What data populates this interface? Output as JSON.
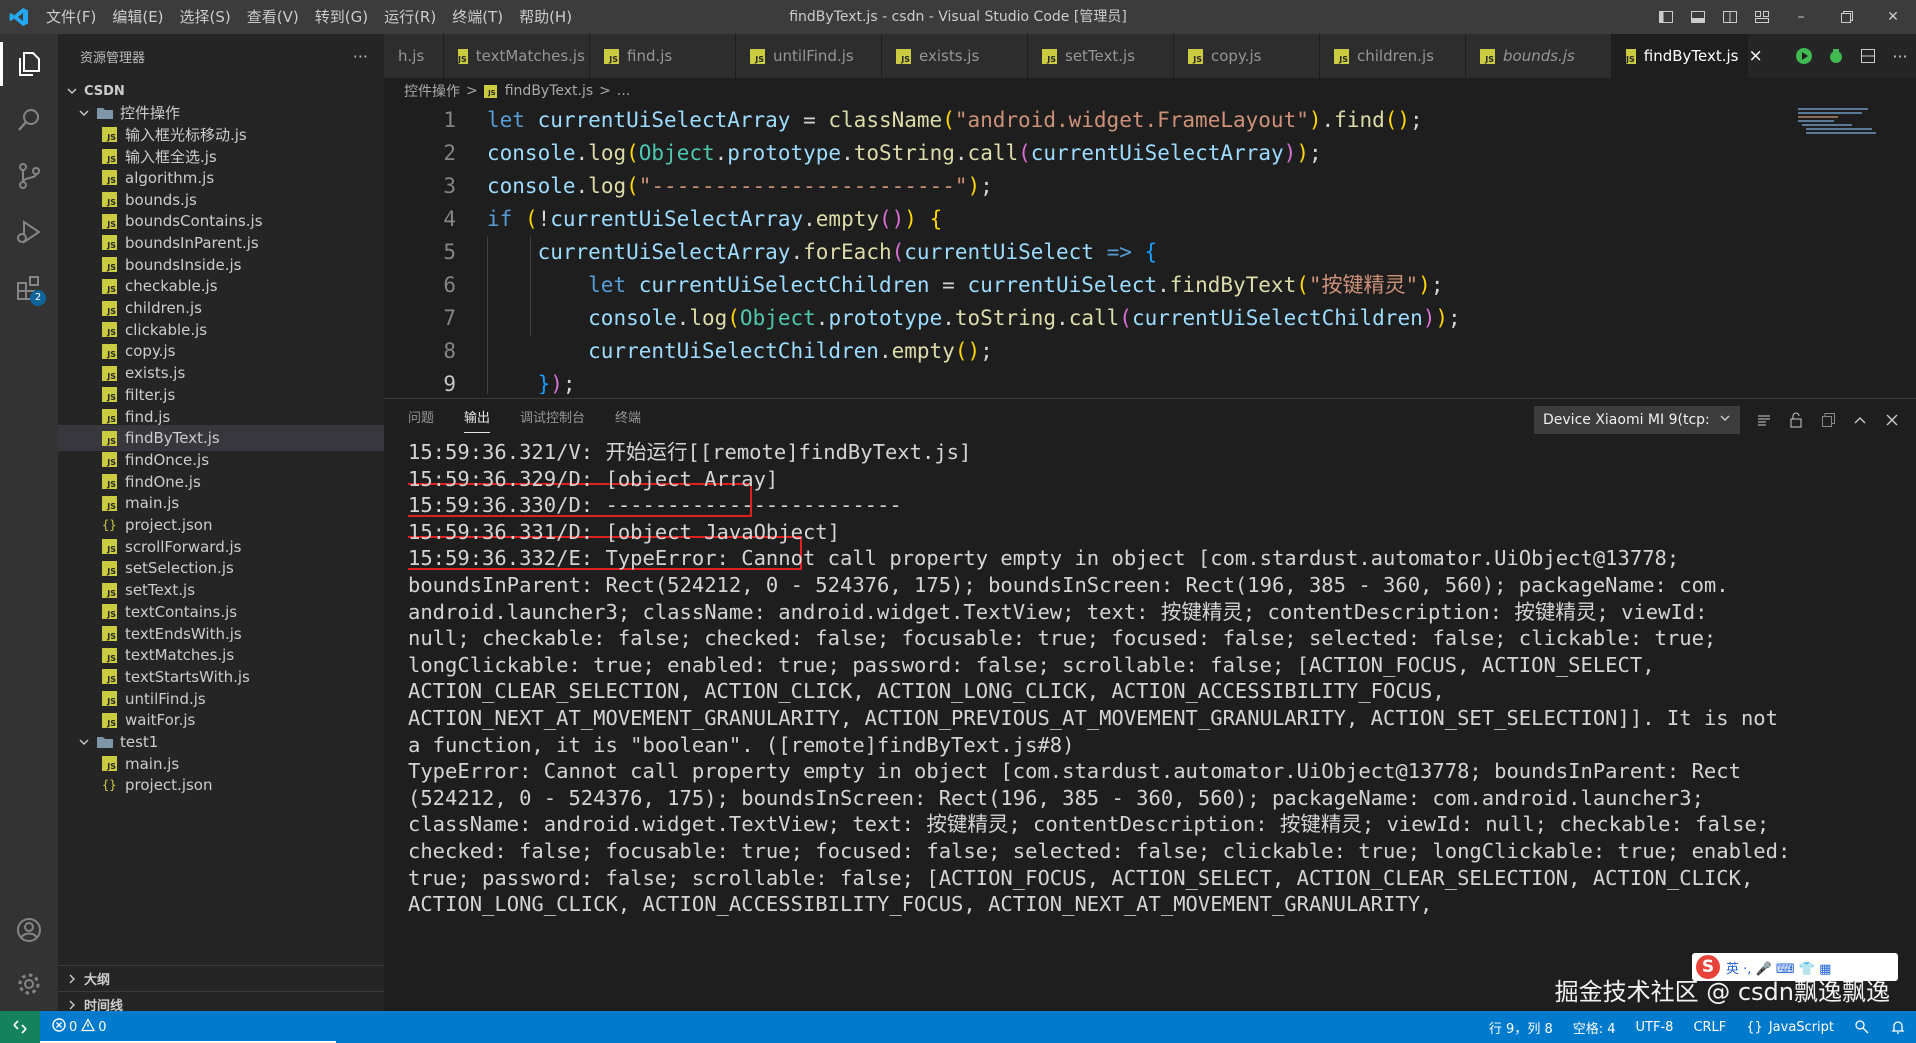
{
  "window": {
    "title": "findByText.js - csdn - Visual Studio Code [管理员]",
    "menu": [
      "文件(F)",
      "编辑(E)",
      "选择(S)",
      "查看(V)",
      "转到(G)",
      "运行(R)",
      "终端(T)",
      "帮助(H)"
    ]
  },
  "activity": {
    "extensions_badge": "2"
  },
  "sidebar": {
    "header": "资源管理器",
    "more": "···",
    "root": "CSDN",
    "folder1": "控件操作",
    "files1": [
      "输入框光标移动.js",
      "输入框全选.js",
      "algorithm.js",
      "bounds.js",
      "boundsContains.js",
      "boundsInParent.js",
      "boundsInside.js",
      "checkable.js",
      "children.js",
      "clickable.js",
      "copy.js",
      "exists.js",
      "filter.js",
      "find.js",
      "findByText.js",
      "findOnce.js",
      "findOne.js",
      "main.js",
      "project.json",
      "scrollForward.js",
      "setSelection.js",
      "setText.js",
      "textContains.js",
      "textEndsWith.js",
      "textMatches.js",
      "textStartsWith.js",
      "untilFind.js",
      "waitFor.js"
    ],
    "folder2": "test1",
    "files2": [
      "main.js",
      "project.json"
    ],
    "outline": "大纲",
    "timeline": "时间线"
  },
  "tabs": [
    {
      "label": "h.js",
      "active": false
    },
    {
      "label": "textMatches.js",
      "active": false
    },
    {
      "label": "find.js",
      "active": false
    },
    {
      "label": "untilFind.js",
      "active": false
    },
    {
      "label": "exists.js",
      "active": false
    },
    {
      "label": "setText.js",
      "active": false
    },
    {
      "label": "copy.js",
      "active": false
    },
    {
      "label": "children.js",
      "active": false
    },
    {
      "label": "bounds.js",
      "active": false
    },
    {
      "label": "findByText.js",
      "active": true
    }
  ],
  "breadcrumb": {
    "folder": "控件操作",
    "file": "findByText.js",
    "more": "..."
  },
  "code_lines": [
    {
      "n": "1",
      "tokens": [
        [
          "kw",
          "let "
        ],
        [
          "var",
          "currentUiSelectArray"
        ],
        [
          "pun",
          " = "
        ],
        [
          "fn",
          "className"
        ],
        [
          "br1",
          "("
        ],
        [
          "str",
          "\"android.widget.FrameLayout\""
        ],
        [
          "br1",
          ")"
        ],
        [
          "pun",
          "."
        ],
        [
          "fn",
          "find"
        ],
        [
          "br1",
          "()"
        ],
        [
          "pun",
          ";"
        ]
      ]
    },
    {
      "n": "2",
      "tokens": [
        [
          "var",
          "console"
        ],
        [
          "pun",
          "."
        ],
        [
          "fn",
          "log"
        ],
        [
          "br1",
          "("
        ],
        [
          "cls",
          "Object"
        ],
        [
          "pun",
          "."
        ],
        [
          "var",
          "prototype"
        ],
        [
          "pun",
          "."
        ],
        [
          "fn",
          "toString"
        ],
        [
          "pun",
          "."
        ],
        [
          "fn",
          "call"
        ],
        [
          "br2",
          "("
        ],
        [
          "var",
          "currentUiSelectArray"
        ],
        [
          "br2",
          ")"
        ],
        [
          "br1",
          ")"
        ],
        [
          "pun",
          ";"
        ]
      ]
    },
    {
      "n": "3",
      "tokens": [
        [
          "var",
          "console"
        ],
        [
          "pun",
          "."
        ],
        [
          "fn",
          "log"
        ],
        [
          "br1",
          "("
        ],
        [
          "str",
          "\"------------------------\""
        ],
        [
          "br1",
          ")"
        ],
        [
          "pun",
          ";"
        ]
      ]
    },
    {
      "n": "4",
      "tokens": [
        [
          "kw",
          "if "
        ],
        [
          "br1",
          "("
        ],
        [
          "pun",
          "!"
        ],
        [
          "var",
          "currentUiSelectArray"
        ],
        [
          "pun",
          "."
        ],
        [
          "fn",
          "empty"
        ],
        [
          "br2",
          "()"
        ],
        [
          "br1",
          ")"
        ],
        [
          "pun",
          " "
        ],
        [
          "br1",
          "{"
        ]
      ]
    },
    {
      "n": "5",
      "tokens": [
        [
          "pun",
          "    "
        ],
        [
          "var",
          "currentUiSelectArray"
        ],
        [
          "pun",
          "."
        ],
        [
          "fn",
          "forEach"
        ],
        [
          "br2",
          "("
        ],
        [
          "var",
          "currentUiSelect"
        ],
        [
          "pun",
          " "
        ],
        [
          "kw",
          "=>"
        ],
        [
          "pun",
          " "
        ],
        [
          "br3",
          "{"
        ]
      ]
    },
    {
      "n": "6",
      "tokens": [
        [
          "pun",
          "        "
        ],
        [
          "kw",
          "let "
        ],
        [
          "var",
          "currentUiSelectChildren"
        ],
        [
          "pun",
          " = "
        ],
        [
          "var",
          "currentUiSelect"
        ],
        [
          "pun",
          "."
        ],
        [
          "fn",
          "findByText"
        ],
        [
          "br1",
          "("
        ],
        [
          "str",
          "\"按键精灵\""
        ],
        [
          "br1",
          ")"
        ],
        [
          "pun",
          ";"
        ]
      ]
    },
    {
      "n": "7",
      "tokens": [
        [
          "pun",
          "        "
        ],
        [
          "var",
          "console"
        ],
        [
          "pun",
          "."
        ],
        [
          "fn",
          "log"
        ],
        [
          "br1",
          "("
        ],
        [
          "cls",
          "Object"
        ],
        [
          "pun",
          "."
        ],
        [
          "var",
          "prototype"
        ],
        [
          "pun",
          "."
        ],
        [
          "fn",
          "toString"
        ],
        [
          "pun",
          "."
        ],
        [
          "fn",
          "call"
        ],
        [
          "br2",
          "("
        ],
        [
          "var",
          "currentUiSelectChildren"
        ],
        [
          "br2",
          ")"
        ],
        [
          "br1",
          ")"
        ],
        [
          "pun",
          ";"
        ]
      ]
    },
    {
      "n": "8",
      "tokens": [
        [
          "pun",
          "        "
        ],
        [
          "var",
          "currentUiSelectChildren"
        ],
        [
          "pun",
          "."
        ],
        [
          "fn",
          "empty"
        ],
        [
          "br1",
          "()"
        ],
        [
          "pun",
          ";"
        ]
      ]
    },
    {
      "n": "9",
      "tokens": [
        [
          "pun",
          "    "
        ],
        [
          "br3",
          "}"
        ],
        [
          "br2",
          ")"
        ],
        [
          "pun",
          ";"
        ]
      ]
    }
  ],
  "panel": {
    "tabs": [
      "问题",
      "输出",
      "调试控制台",
      "终端"
    ],
    "active_tab": "输出",
    "device": "Device Xiaomi MI 9(tcp:"
  },
  "output_lines": [
    "15:59:36.321/V: 开始运行[[remote]findByText.js]",
    "15:59:36.329/D: [object Array]",
    "15:59:36.330/D: ------------------------",
    "15:59:36.331/D: [object JavaObject]",
    "15:59:36.332/E: TypeError: Cannot call property empty in object [com.stardust.automator.UiObject@13778;",
    "boundsInParent: Rect(524212, 0 - 524376, 175); boundsInScreen: Rect(196, 385 - 360, 560); packageName: com.",
    "android.launcher3; className: android.widget.TextView; text: 按键精灵; contentDescription: 按键精灵; viewId:",
    "null; checkable: false; checked: false; focusable: true; focused: false; selected: false; clickable: true;",
    "longClickable: true; enabled: true; password: false; scrollable: false; [ACTION_FOCUS, ACTION_SELECT,",
    "ACTION_CLEAR_SELECTION, ACTION_CLICK, ACTION_LONG_CLICK, ACTION_ACCESSIBILITY_FOCUS,",
    "ACTION_NEXT_AT_MOVEMENT_GRANULARITY, ACTION_PREVIOUS_AT_MOVEMENT_GRANULARITY, ACTION_SET_SELECTION]]. It is not",
    "a function, it is \"boolean\". ([remote]findByText.js#8)",
    "TypeError: Cannot call property empty in object [com.stardust.automator.UiObject@13778; boundsInParent: Rect",
    "(524212, 0 - 524376, 175); boundsInScreen: Rect(196, 385 - 360, 560); packageName: com.android.launcher3;",
    "className: android.widget.TextView; text: 按键精灵; contentDescription: 按键精灵; viewId: null; checkable: false;",
    "checked: false; focusable: true; focused: false; selected: false; clickable: true; longClickable: true; enabled:",
    "true; password: false; scrollable: false; [ACTION_FOCUS, ACTION_SELECT, ACTION_CLEAR_SELECTION, ACTION_CLICK,",
    "ACTION_LONG_CLICK, ACTION_ACCESSIBILITY_FOCUS, ACTION_NEXT_AT_MOVEMENT_GRANULARITY,"
  ],
  "ime": {
    "logo": "S",
    "text": "英 ·, 🎤 ⌨ 👕 ▦"
  },
  "watermark": "掘金技术社区 @ csdn飘逸飘逸",
  "statusbar": {
    "errors": "0",
    "warnings": "0",
    "position": "行 9，列 8",
    "spaces": "空格: 4",
    "encoding": "UTF-8",
    "eol": "CRLF",
    "language": "JavaScript"
  },
  "colors": {
    "accent": "#007acc",
    "highlight_box": "#e02020",
    "remote": "#16825d"
  }
}
